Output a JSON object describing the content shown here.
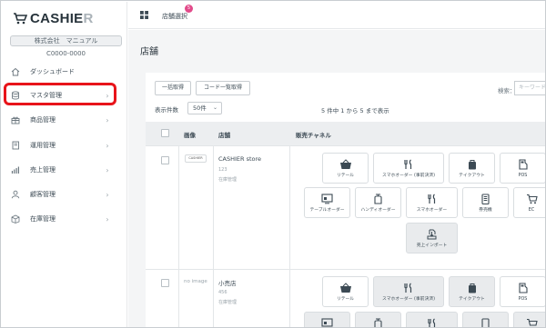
{
  "app": {
    "logo_main": "CASHIE",
    "logo_tail": "R"
  },
  "sidebar": {
    "company_name": "株式会社　マニュアル",
    "company_code": "C0000-0000",
    "items": [
      {
        "label": "ダッシュボード",
        "icon": "home-icon",
        "has_chevron": false
      },
      {
        "label": "マスタ管理",
        "icon": "database-icon",
        "has_chevron": true
      },
      {
        "label": "商品管理",
        "icon": "gift-icon",
        "has_chevron": true
      },
      {
        "label": "運用管理",
        "icon": "book-icon",
        "has_chevron": true
      },
      {
        "label": "売上管理",
        "icon": "bar-chart-icon",
        "has_chevron": true
      },
      {
        "label": "顧客管理",
        "icon": "user-icon",
        "has_chevron": true
      },
      {
        "label": "在庫管理",
        "icon": "box-icon",
        "has_chevron": true
      }
    ],
    "highlight_color": "#e8141a"
  },
  "topbar": {
    "store_select": "店舗選択",
    "badge": "5"
  },
  "page": {
    "title": "店舗"
  },
  "toolbar": {
    "bulk_fetch": "一括取得",
    "code_list_fetch": "コード一覧取得",
    "search_label": "検索：",
    "search_placeholder": "キーワード",
    "per_page_label": "表示件数",
    "per_page_value": "50件",
    "count_text": "5 件中 1 から 5 まで表示"
  },
  "table": {
    "headers": {
      "image": "画像",
      "store": "店舗",
      "channels": "販売チャネル"
    },
    "rows": [
      {
        "image_label": "CASHIER",
        "name": "CASHIER store",
        "code": "123",
        "note": "在庫管理",
        "channels": [
          {
            "label": "リテール",
            "icon": "basket-icon"
          },
          {
            "label": "スマホオーダー (事前決済)",
            "icon": "cutlery-icon"
          },
          {
            "label": "テイクアウト",
            "icon": "takeout-bag-icon"
          },
          {
            "label": "POS",
            "icon": "pos-icon"
          },
          {
            "label": "テーブルオーダー",
            "icon": "table-order-icon"
          },
          {
            "label": "ハンディオーダー",
            "icon": "handy-icon"
          },
          {
            "label": "スマホオーダー",
            "icon": "cutlery-icon"
          },
          {
            "label": "券売機",
            "icon": "ticket-machine-icon"
          },
          {
            "label": "EC",
            "icon": "cart-icon"
          },
          {
            "label": "売上インポート",
            "icon": "import-icon"
          }
        ]
      },
      {
        "image_label": "no image",
        "name": "小売店",
        "code": "456",
        "note": "在庫管理",
        "channels": [
          {
            "label": "リテール",
            "icon": "basket-icon"
          },
          {
            "label": "スマホオーダー (事前決済)",
            "icon": "cutlery-icon"
          },
          {
            "label": "テイクアウト",
            "icon": "takeout-bag-icon"
          },
          {
            "label": "POS",
            "icon": "pos-icon"
          }
        ]
      }
    ]
  }
}
